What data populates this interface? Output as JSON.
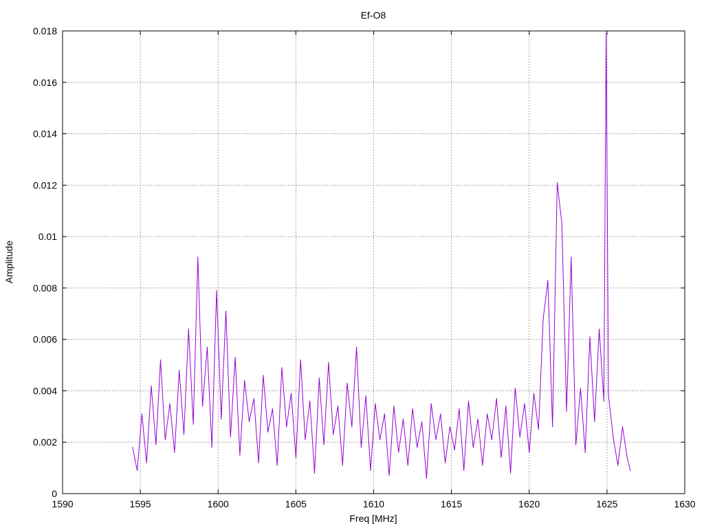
{
  "chart_data": {
    "type": "line",
    "title": "Ef-O8",
    "xlabel": "Freq [MHz]",
    "ylabel": "Amplitude",
    "xlim": [
      1590,
      1630
    ],
    "ylim": [
      0,
      0.018
    ],
    "grid": true,
    "x_ticks": [
      "1590",
      "1595",
      "1600",
      "1605",
      "1610",
      "1615",
      "1620",
      "1625",
      "1630"
    ],
    "y_ticks": [
      "0",
      "0.002",
      "0.004",
      "0.006",
      "0.008",
      "0.01",
      "0.012",
      "0.014",
      "0.016",
      "0.018"
    ],
    "series_color": "#9400d3",
    "series": [
      {
        "x": [
          1594.5,
          1594.8,
          1595.1,
          1595.4,
          1595.7,
          1596.0,
          1596.3,
          1596.6,
          1596.9,
          1597.2,
          1597.5,
          1597.8,
          1598.1,
          1598.4,
          1598.7,
          1599.0,
          1599.3,
          1599.6,
          1599.9,
          1600.2,
          1600.5,
          1600.8,
          1601.1,
          1601.4,
          1601.7,
          1602.0,
          1602.3,
          1602.6,
          1602.9,
          1603.2,
          1603.5,
          1603.8,
          1604.1,
          1604.4,
          1604.7,
          1605.0,
          1605.3,
          1605.6,
          1605.9,
          1606.2,
          1606.5,
          1606.8,
          1607.1,
          1607.4,
          1607.7,
          1608.0,
          1608.3,
          1608.6,
          1608.9,
          1609.2,
          1609.5,
          1609.8,
          1610.1,
          1610.4,
          1610.7,
          1611.0,
          1611.3,
          1611.6,
          1611.9,
          1612.2,
          1612.5,
          1612.8,
          1613.1,
          1613.4,
          1613.7,
          1614.0,
          1614.3,
          1614.6,
          1614.9,
          1615.2,
          1615.5,
          1615.8,
          1616.1,
          1616.4,
          1616.7,
          1617.0,
          1617.3,
          1617.6,
          1617.9,
          1618.2,
          1618.5,
          1618.8,
          1619.1,
          1619.4,
          1619.7,
          1620.0,
          1620.3,
          1620.6,
          1620.9,
          1621.2,
          1621.5,
          1621.8,
          1622.1,
          1622.4,
          1622.7,
          1623.0,
          1623.3,
          1623.6,
          1623.9,
          1624.2,
          1624.5,
          1624.8,
          1624.95,
          1625.1,
          1625.4,
          1625.7,
          1626.0,
          1626.3,
          1626.5
        ],
        "y": [
          0.0018,
          0.0009,
          0.0031,
          0.0012,
          0.0042,
          0.0019,
          0.0052,
          0.0021,
          0.0035,
          0.0016,
          0.0048,
          0.0023,
          0.0064,
          0.0027,
          0.0092,
          0.0034,
          0.0057,
          0.0018,
          0.0079,
          0.0029,
          0.0071,
          0.0022,
          0.0053,
          0.0015,
          0.0044,
          0.0028,
          0.0037,
          0.0012,
          0.0046,
          0.0024,
          0.0033,
          0.0011,
          0.0049,
          0.0026,
          0.0039,
          0.0014,
          0.0052,
          0.0021,
          0.0036,
          0.0008,
          0.0045,
          0.0019,
          0.0051,
          0.0023,
          0.0034,
          0.0011,
          0.0043,
          0.0026,
          0.0057,
          0.0018,
          0.0038,
          0.0009,
          0.0035,
          0.0021,
          0.0031,
          0.0007,
          0.0034,
          0.0016,
          0.0029,
          0.0011,
          0.0033,
          0.0018,
          0.0028,
          0.0006,
          0.0035,
          0.0021,
          0.0031,
          0.0012,
          0.0026,
          0.0017,
          0.0033,
          0.0009,
          0.0036,
          0.0018,
          0.0029,
          0.0011,
          0.0031,
          0.0021,
          0.0037,
          0.0014,
          0.0034,
          0.0008,
          0.0041,
          0.0022,
          0.0035,
          0.0016,
          0.0039,
          0.0025,
          0.0068,
          0.0083,
          0.0026,
          0.0121,
          0.0105,
          0.0032,
          0.0092,
          0.0019,
          0.0041,
          0.0016,
          0.0061,
          0.0028,
          0.0064,
          0.0036,
          0.0179,
          0.0038,
          0.0022,
          0.0011,
          0.0026,
          0.0014,
          0.0009
        ]
      }
    ]
  }
}
